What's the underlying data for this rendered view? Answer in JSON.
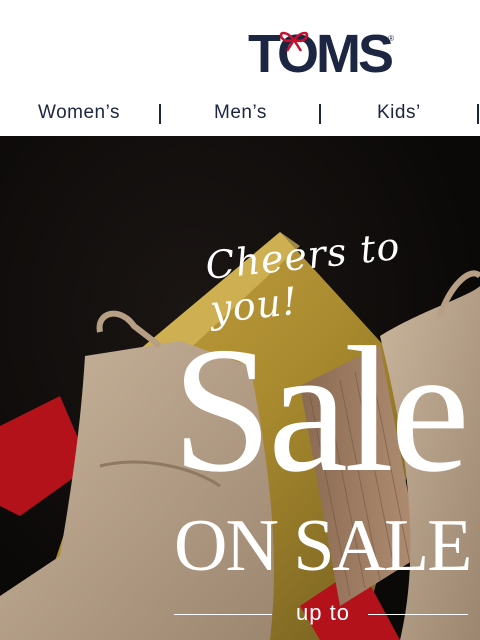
{
  "brand": {
    "name": "TOMS",
    "mark": "®",
    "bow_color": "#c8102e",
    "text_color": "#1c2541"
  },
  "nav": {
    "items": [
      {
        "label": "Women’s"
      },
      {
        "label": "Men’s"
      },
      {
        "label": "Kids’"
      }
    ]
  },
  "hero": {
    "tagline": "Cheers to you!",
    "headline": "Sale",
    "subheadline": "ON SALE",
    "offer_prefix": "up to"
  }
}
